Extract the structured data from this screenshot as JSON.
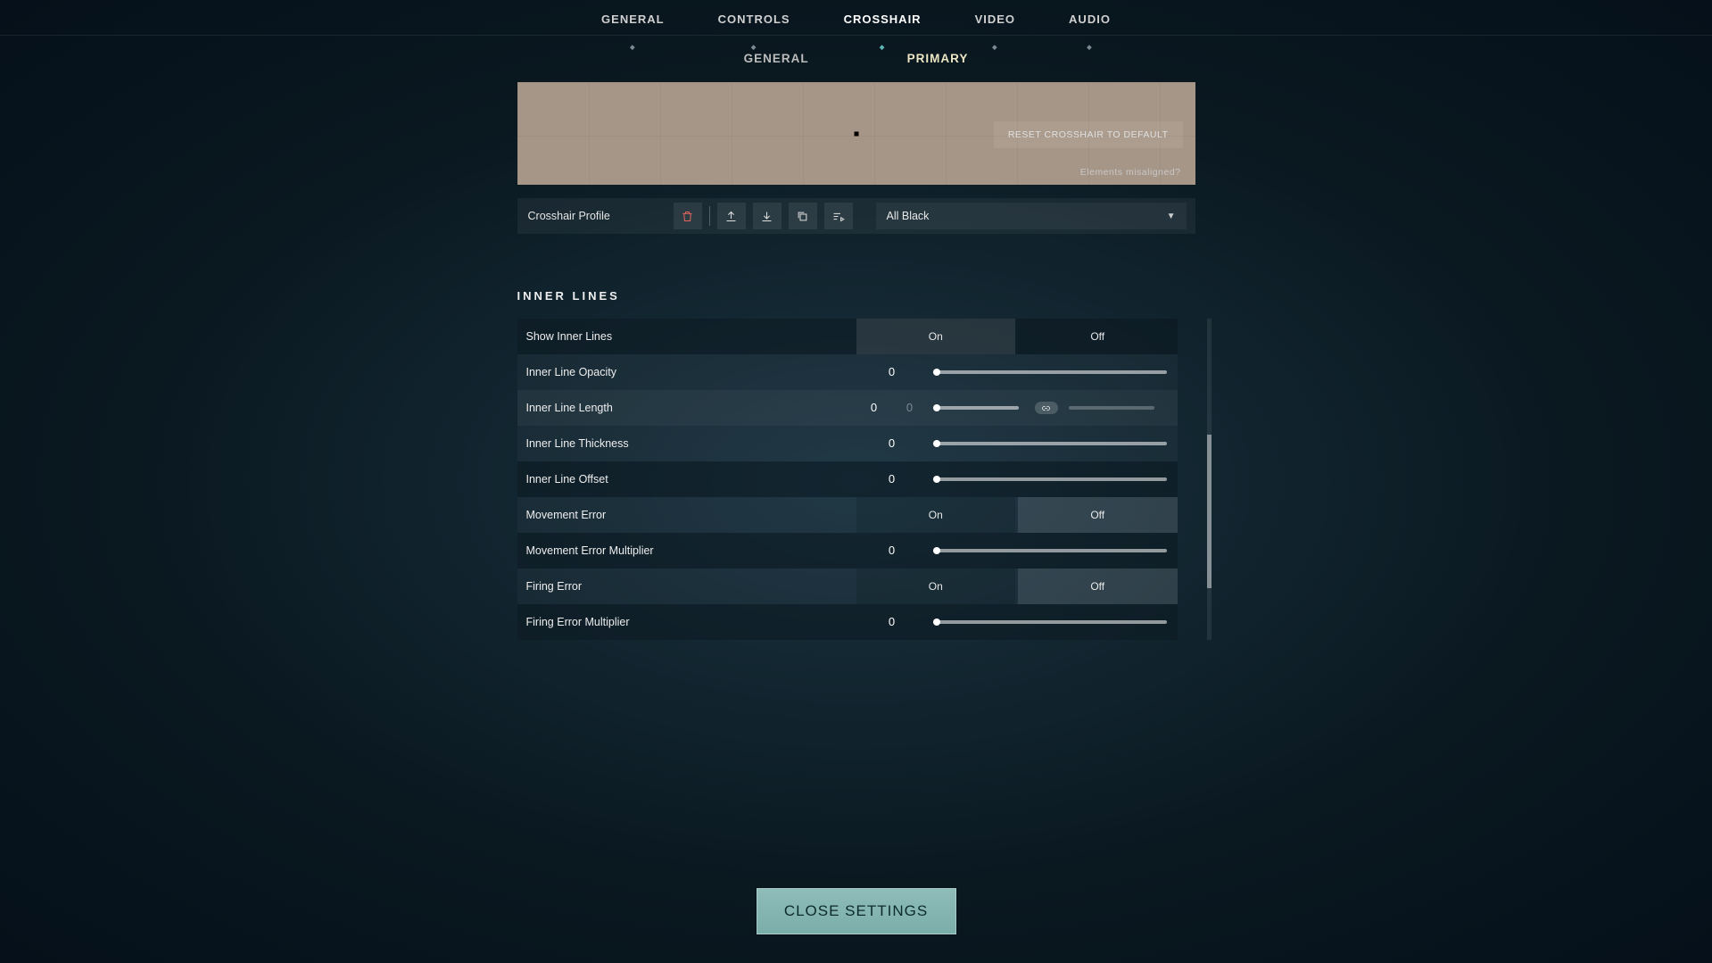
{
  "tabs": {
    "items": [
      "GENERAL",
      "CONTROLS",
      "CROSSHAIR",
      "VIDEO",
      "AUDIO"
    ],
    "active": 2
  },
  "subtabs": {
    "items": [
      "GENERAL",
      "PRIMARY"
    ],
    "active": 1
  },
  "preview": {
    "reset_label": "RESET CROSSHAIR TO DEFAULT",
    "misaligned_label": "Elements misaligned?"
  },
  "profile": {
    "label": "Crosshair Profile",
    "selected": "All Black"
  },
  "section": {
    "title": "INNER LINES"
  },
  "toggles": {
    "on": "On",
    "off": "Off"
  },
  "rows": [
    {
      "label": "Show Inner Lines",
      "type": "toggle",
      "value": "On"
    },
    {
      "label": "Inner Line Opacity",
      "type": "slider",
      "value": "0"
    },
    {
      "label": "Inner Line Length",
      "type": "dual",
      "value": "0",
      "value2": "0"
    },
    {
      "label": "Inner Line Thickness",
      "type": "slider",
      "value": "0"
    },
    {
      "label": "Inner Line Offset",
      "type": "slider",
      "value": "0"
    },
    {
      "label": "Movement Error",
      "type": "toggle",
      "value": "Off"
    },
    {
      "label": "Movement Error Multiplier",
      "type": "slider",
      "value": "0"
    },
    {
      "label": "Firing Error",
      "type": "toggle",
      "value": "Off"
    },
    {
      "label": "Firing Error Multiplier",
      "type": "slider",
      "value": "0"
    }
  ],
  "close_label": "CLOSE SETTINGS"
}
